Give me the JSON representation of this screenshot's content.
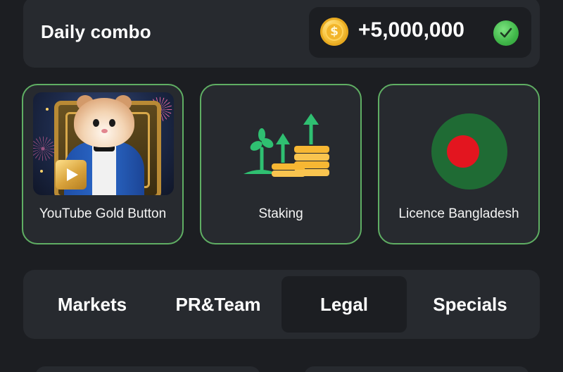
{
  "daily_combo": {
    "title": "Daily combo",
    "reward": "+5,000,000",
    "coin_symbol": "$",
    "coin_icon": "coin-icon",
    "status_icon": "checkmark-circle-icon"
  },
  "cards": [
    {
      "label": "YouTube Gold Button",
      "image": "hamster-youtube-gold-button-image"
    },
    {
      "label": "Staking",
      "image": "staking-plants-coins-icon"
    },
    {
      "label": "Licence Bangladesh",
      "image": "bangladesh-flag-icon"
    }
  ],
  "tabs": [
    {
      "label": "Markets",
      "active": false
    },
    {
      "label": "PR&Team",
      "active": false
    },
    {
      "label": "Legal",
      "active": true
    },
    {
      "label": "Specials",
      "active": false
    }
  ],
  "colors": {
    "background": "#1c1e22",
    "card": "#272a2f",
    "card_border_active": "#5fae63",
    "accent_green": "#3fb548",
    "coin_gold": "#f7c23b",
    "flag_green": "#1f6b34",
    "flag_red": "#e3151f"
  }
}
